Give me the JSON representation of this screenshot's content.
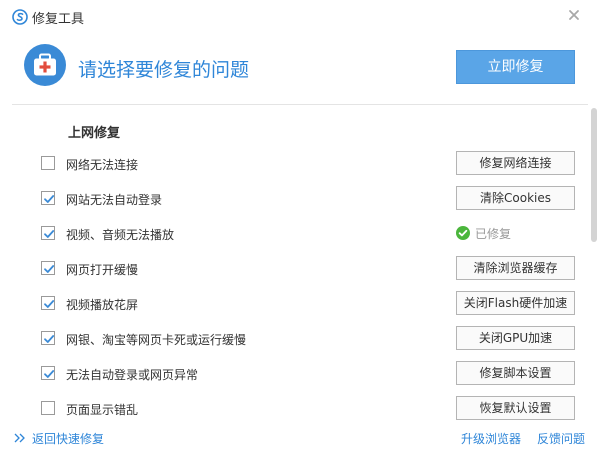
{
  "window": {
    "title": "修复工具"
  },
  "header": {
    "title": "请选择要修复的问题",
    "fix_now_label": "立即修复"
  },
  "section": {
    "title": "上网修复"
  },
  "rows": [
    {
      "label": "网络无法连接",
      "checked": false,
      "action": "修复网络连接"
    },
    {
      "label": "网站无法自动登录",
      "checked": true,
      "action": "清除Cookies"
    },
    {
      "label": "视频、音频无法播放",
      "checked": true,
      "status": "已修复"
    },
    {
      "label": "网页打开缓慢",
      "checked": true,
      "action": "清除浏览器缓存"
    },
    {
      "label": "视频播放花屏",
      "checked": true,
      "action": "关闭Flash硬件加速"
    },
    {
      "label": "网银、淘宝等网页卡死或运行缓慢",
      "checked": true,
      "action": "关闭GPU加速"
    },
    {
      "label": "无法自动登录或网页异常",
      "checked": true,
      "action": "修复脚本设置"
    },
    {
      "label": "页面显示错乱",
      "checked": false,
      "action": "恢复默认设置"
    }
  ],
  "footer": {
    "back_label": "返回快速修复",
    "upgrade_label": "升级浏览器",
    "feedback_label": "反馈问题"
  },
  "colors": {
    "accent": "#2f86d8",
    "button": "#5aa5e7",
    "check": "#3a8ad6",
    "success": "#4bb63c"
  },
  "icons": {
    "logo": "browser-logo-icon",
    "close": "close-icon",
    "kit": "first-aid-kit-icon",
    "check": "checkmark-icon",
    "success": "success-icon",
    "back": "double-chevron-right-icon"
  }
}
